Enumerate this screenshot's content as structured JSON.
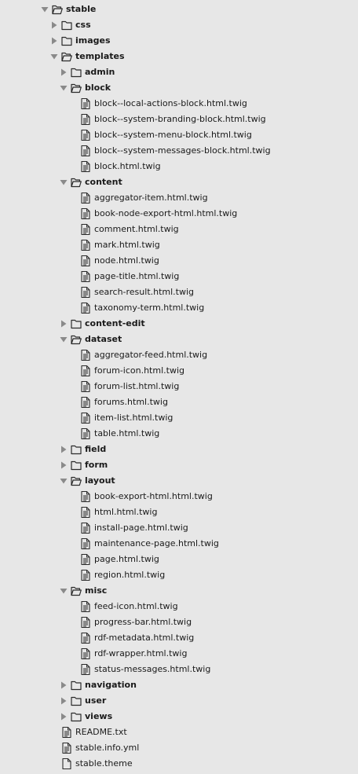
{
  "tree": [
    {
      "depth": 0,
      "type": "folder",
      "open": true,
      "label": "stable"
    },
    {
      "depth": 1,
      "type": "folder",
      "open": false,
      "label": "css"
    },
    {
      "depth": 1,
      "type": "folder",
      "open": false,
      "label": "images"
    },
    {
      "depth": 1,
      "type": "folder",
      "open": true,
      "label": "templates"
    },
    {
      "depth": 2,
      "type": "folder",
      "open": false,
      "label": "admin"
    },
    {
      "depth": 2,
      "type": "folder",
      "open": true,
      "label": "block"
    },
    {
      "depth": 3,
      "type": "file",
      "label": "block--local-actions-block.html.twig"
    },
    {
      "depth": 3,
      "type": "file",
      "label": "block--system-branding-block.html.twig"
    },
    {
      "depth": 3,
      "type": "file",
      "label": "block--system-menu-block.html.twig"
    },
    {
      "depth": 3,
      "type": "file",
      "label": "block--system-messages-block.html.twig"
    },
    {
      "depth": 3,
      "type": "file",
      "label": "block.html.twig"
    },
    {
      "depth": 2,
      "type": "folder",
      "open": true,
      "label": "content"
    },
    {
      "depth": 3,
      "type": "file",
      "label": "aggregator-item.html.twig"
    },
    {
      "depth": 3,
      "type": "file",
      "label": "book-node-export-html.html.twig"
    },
    {
      "depth": 3,
      "type": "file",
      "label": "comment.html.twig"
    },
    {
      "depth": 3,
      "type": "file",
      "label": "mark.html.twig"
    },
    {
      "depth": 3,
      "type": "file",
      "label": "node.html.twig"
    },
    {
      "depth": 3,
      "type": "file",
      "label": "page-title.html.twig"
    },
    {
      "depth": 3,
      "type": "file",
      "label": "search-result.html.twig"
    },
    {
      "depth": 3,
      "type": "file",
      "label": "taxonomy-term.html.twig"
    },
    {
      "depth": 2,
      "type": "folder",
      "open": false,
      "label": "content-edit"
    },
    {
      "depth": 2,
      "type": "folder",
      "open": true,
      "label": "dataset"
    },
    {
      "depth": 3,
      "type": "file",
      "label": "aggregator-feed.html.twig"
    },
    {
      "depth": 3,
      "type": "file",
      "label": "forum-icon.html.twig"
    },
    {
      "depth": 3,
      "type": "file",
      "label": "forum-list.html.twig"
    },
    {
      "depth": 3,
      "type": "file",
      "label": "forums.html.twig"
    },
    {
      "depth": 3,
      "type": "file",
      "label": "item-list.html.twig"
    },
    {
      "depth": 3,
      "type": "file",
      "label": "table.html.twig"
    },
    {
      "depth": 2,
      "type": "folder",
      "open": false,
      "label": "field"
    },
    {
      "depth": 2,
      "type": "folder",
      "open": false,
      "label": "form"
    },
    {
      "depth": 2,
      "type": "folder",
      "open": true,
      "label": "layout"
    },
    {
      "depth": 3,
      "type": "file",
      "label": "book-export-html.html.twig"
    },
    {
      "depth": 3,
      "type": "file",
      "label": "html.html.twig"
    },
    {
      "depth": 3,
      "type": "file",
      "label": "install-page.html.twig"
    },
    {
      "depth": 3,
      "type": "file",
      "label": "maintenance-page.html.twig"
    },
    {
      "depth": 3,
      "type": "file",
      "label": "page.html.twig"
    },
    {
      "depth": 3,
      "type": "file",
      "label": "region.html.twig"
    },
    {
      "depth": 2,
      "type": "folder",
      "open": true,
      "label": "misc"
    },
    {
      "depth": 3,
      "type": "file",
      "label": "feed-icon.html.twig"
    },
    {
      "depth": 3,
      "type": "file",
      "label": "progress-bar.html.twig"
    },
    {
      "depth": 3,
      "type": "file",
      "label": "rdf-metadata.html.twig"
    },
    {
      "depth": 3,
      "type": "file",
      "label": "rdf-wrapper.html.twig"
    },
    {
      "depth": 3,
      "type": "file",
      "label": "status-messages.html.twig"
    },
    {
      "depth": 2,
      "type": "folder",
      "open": false,
      "label": "navigation"
    },
    {
      "depth": 2,
      "type": "folder",
      "open": false,
      "label": "user"
    },
    {
      "depth": 2,
      "type": "folder",
      "open": false,
      "label": "views"
    },
    {
      "depth": 1,
      "type": "file",
      "label": "README.txt"
    },
    {
      "depth": 1,
      "type": "file",
      "label": "stable.info.yml"
    },
    {
      "depth": 1,
      "type": "file",
      "label": "stable.theme",
      "icon": "plain"
    }
  ],
  "colors": {
    "background": "#e7e7e7",
    "text": "#1a1a1a",
    "twisty": "#8a8a8a",
    "icon": "#2b2b2b"
  }
}
